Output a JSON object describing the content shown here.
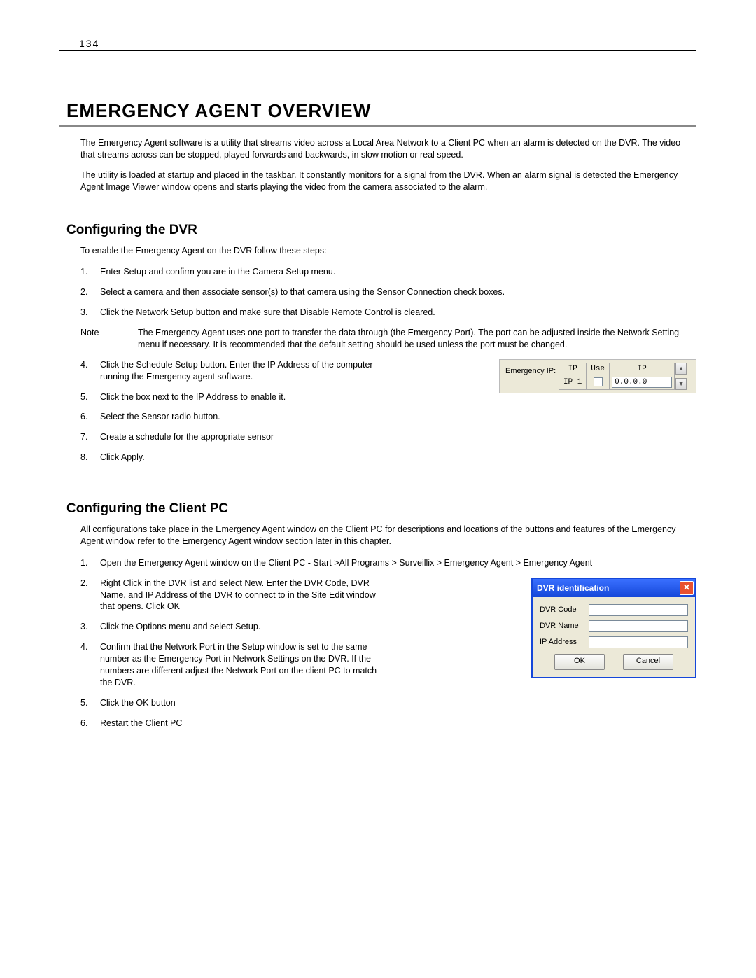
{
  "page_number": "134",
  "main_heading": "EMERGENCY AGENT OVERVIEW",
  "intro_p1": "The Emergency Agent software is a utility that streams video across a Local Area Network to a Client PC when an alarm is detected on the DVR. The video that streams across can be stopped, played forwards and backwards, in slow motion or real speed.",
  "intro_p2": "The utility is loaded at startup and placed in the taskbar. It constantly monitors for a signal from the DVR. When an alarm signal is detected the Emergency Agent Image Viewer window opens and starts playing the video from the camera associated to the alarm.",
  "section_dvr": {
    "heading": "Configuring the DVR",
    "intro": "To enable the Emergency Agent on the DVR follow these steps:",
    "steps_a": [
      {
        "n": "1.",
        "t": "Enter Setup and confirm you are in the Camera Setup menu."
      },
      {
        "n": "2.",
        "t": "Select a camera and then associate sensor(s) to that camera using the Sensor Connection check boxes."
      },
      {
        "n": "3.",
        "t": "Click the Network Setup button and make sure that Disable Remote Control is cleared."
      }
    ],
    "note_label": "Note",
    "note_text": "The Emergency Agent uses one port to transfer the data through (the Emergency Port). The port can be adjusted inside the Network Setting menu if necessary. It is recommended that the default setting should be used unless the port must be changed.",
    "steps_b": [
      {
        "n": "4.",
        "t": "Click the Schedule Setup button. Enter the IP Address of the computer running the Emergency agent software."
      },
      {
        "n": "5.",
        "t": "Click the box next to the IP Address to enable it."
      },
      {
        "n": "6.",
        "t": "Select the Sensor radio button."
      },
      {
        "n": "7.",
        "t": "Create a schedule for the appropriate sensor"
      },
      {
        "n": "8.",
        "t": "Click Apply."
      }
    ]
  },
  "emip": {
    "label": "Emergency IP:",
    "col_ip": "IP",
    "col_use": "Use",
    "col_ip2": "IP",
    "row_ip_label": "IP 1",
    "row_ip_value": "0.0.0.0",
    "scroll_up": "▲",
    "scroll_down": "▼"
  },
  "section_client": {
    "heading": "Configuring the Client PC",
    "intro": "All configurations take place in the Emergency Agent window on the Client PC for descriptions and locations of the buttons and features of the Emergency Agent window refer to the Emergency Agent window section later in this chapter.",
    "step1": {
      "n": "1.",
      "t": "Open the Emergency Agent window on the Client PC - Start >All Programs > Surveillix > Emergency Agent > Emergency Agent"
    },
    "steps_b": [
      {
        "n": "2.",
        "t": "Right Click in the DVR list and select New. Enter the DVR Code, DVR Name, and IP Address of the DVR to connect to in the Site Edit window that opens. Click OK"
      },
      {
        "n": "3.",
        "t": "Click the Options menu and select Setup."
      },
      {
        "n": "4.",
        "t": "Confirm that the Network Port in the Setup window is set to the same number as the Emergency Port in Network Settings on the DVR. If the numbers are different adjust the Network Port on the client PC to match the DVR."
      },
      {
        "n": "5.",
        "t": "Click the OK button"
      },
      {
        "n": "6.",
        "t": "Restart the Client PC"
      }
    ]
  },
  "dvr_dialog": {
    "title": "DVR identification",
    "close": "✕",
    "field_code": "DVR Code",
    "field_name": "DVR Name",
    "field_ip": "IP Address",
    "btn_ok": "OK",
    "btn_cancel": "Cancel"
  }
}
